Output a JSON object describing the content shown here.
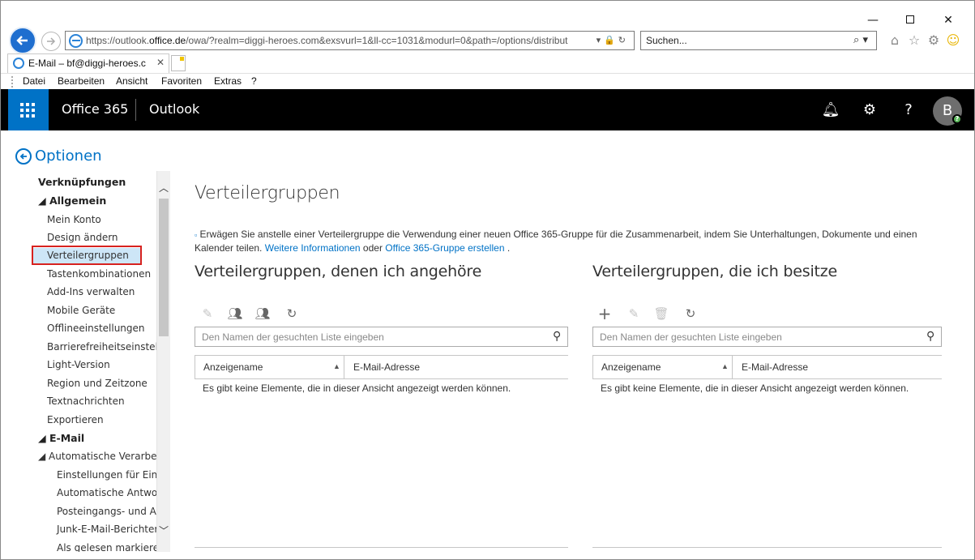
{
  "browser": {
    "url_prefix": "https://outlook.",
    "url_host": "office.de",
    "url_rest": "/owa/?realm=diggi-heroes.com&exsvurl=1&ll-cc=1031&modurl=0&path=/options/distribut",
    "search_placeholder": "Suchen...",
    "tab_title": "E-Mail – bf@diggi-heroes.c",
    "menu": [
      "Datei",
      "Bearbeiten",
      "Ansicht",
      "Favoriten",
      "Extras",
      "?"
    ]
  },
  "header": {
    "brand": "Office 365",
    "app": "Outlook",
    "avatar_initial": "B",
    "presence_badge": "?",
    "accent": "#0072c6"
  },
  "options": {
    "title": "Optionen",
    "nav": [
      {
        "label": "Verknüpfungen",
        "level": 0,
        "heading": true
      },
      {
        "label": "◢ Allgemein",
        "level": 0,
        "heading": true
      },
      {
        "label": "Mein Konto",
        "level": 1
      },
      {
        "label": "Design ändern",
        "level": 1
      },
      {
        "label": "Verteilergruppen",
        "level": 1,
        "selected": true
      },
      {
        "label": "Tastenkombinationen",
        "level": 1
      },
      {
        "label": "Add-Ins verwalten",
        "level": 1
      },
      {
        "label": "Mobile Geräte",
        "level": 1
      },
      {
        "label": "Offlineeinstellungen",
        "level": 1
      },
      {
        "label": "Barrierefreiheitseinstellun",
        "level": 1
      },
      {
        "label": "Light-Version",
        "level": 1
      },
      {
        "label": "Region und Zeitzone",
        "level": 1
      },
      {
        "label": "Textnachrichten",
        "level": 1
      },
      {
        "label": "Exportieren",
        "level": 1
      },
      {
        "label": "◢ E-Mail",
        "level": 0,
        "heading": true
      },
      {
        "label": "◢ Automatische Verarbeitur",
        "level": 1
      },
      {
        "label": "Einstellungen für Einbli",
        "level": 2
      },
      {
        "label": "Automatische Antworte",
        "level": 2
      },
      {
        "label": "Posteingangs- und Auf",
        "level": 2
      },
      {
        "label": "Junk-E-Mail-Berichterst",
        "level": 2
      },
      {
        "label": "Als gelesen markieren",
        "level": 2
      }
    ]
  },
  "main": {
    "title": "Verteilergruppen",
    "info": {
      "text": " Erwägen Sie anstelle einer Verteilergruppe die Verwendung einer neuen Office 365-Gruppe für die Zusammenarbeit, indem Sie Unterhaltungen, Dokumente und einen Kalender teilen.",
      "link1": "Weitere Informationen",
      "mid": "oder",
      "link2": "Office 365-Gruppe erstellen",
      "end": "."
    },
    "member_of": {
      "title": "Verteilergruppen, denen ich angehöre",
      "search_placeholder": "Den Namen der gesuchten Liste eingeben",
      "col1": "Anzeigename",
      "col2": "E-Mail-Adresse",
      "empty": "Es gibt keine Elemente, die in dieser Ansicht angezeigt werden können."
    },
    "owned": {
      "title": "Verteilergruppen, die ich besitze",
      "search_placeholder": "Den Namen der gesuchten Liste eingeben",
      "col1": "Anzeigename",
      "col2": "E-Mail-Adresse",
      "empty": "Es gibt keine Elemente, die in dieser Ansicht angezeigt werden können."
    }
  }
}
